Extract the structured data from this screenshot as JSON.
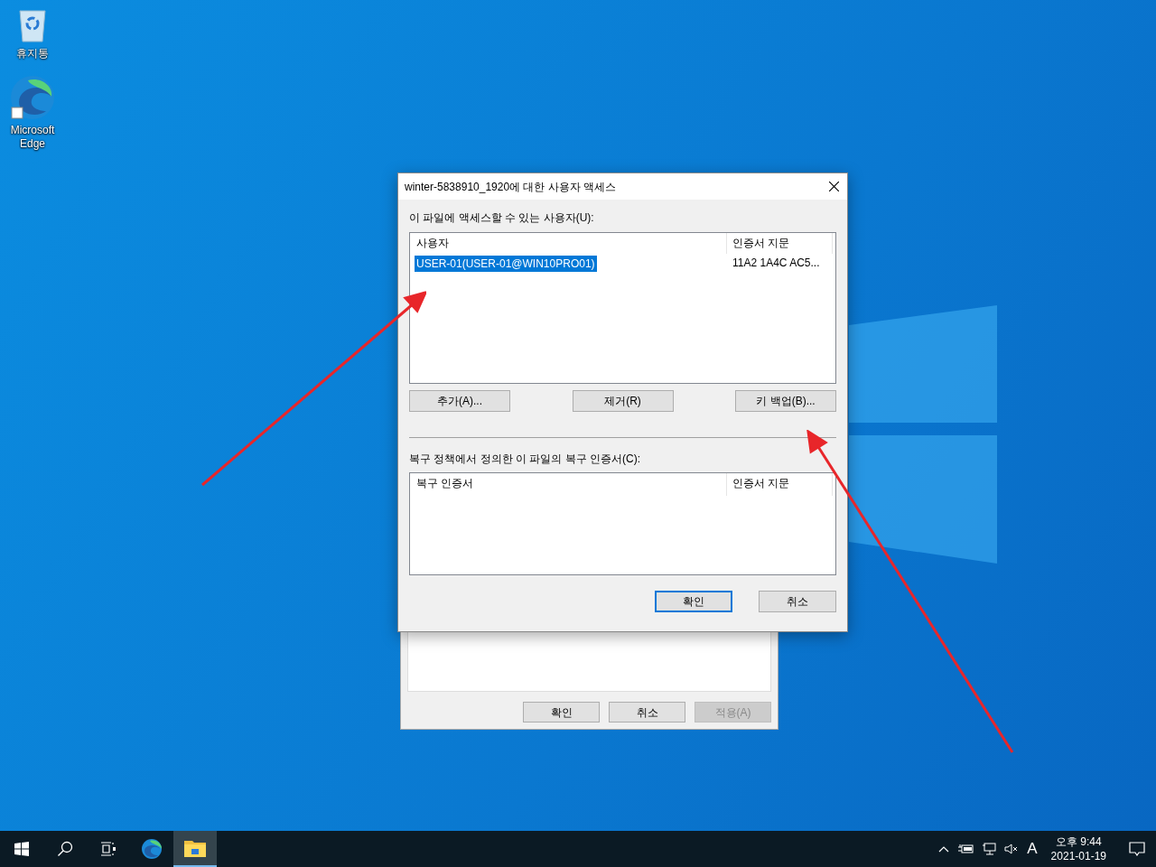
{
  "desktop_icons": [
    {
      "kind": "recycle",
      "label": "휴지통"
    },
    {
      "kind": "edge",
      "label": "Microsoft Edge"
    }
  ],
  "dialog": {
    "title": "winter-5838910_1920에 대한 사용자 액세스",
    "users_label": "이 파일에 액세스할 수 있는 사용자(U):",
    "users_columns": [
      "사용자",
      "인증서 지문"
    ],
    "users_rows": [
      {
        "user": "USER-01(USER-01@WIN10PRO01)",
        "thumbprint": "11A2 1A4C AC5...",
        "selected": true
      }
    ],
    "user_buttons": [
      "추가(A)...",
      "제거(R)",
      "키 백업(B)..."
    ],
    "recovery_label": "복구 정책에서 정의한 이 파일의 복구 인증서(C):",
    "recovery_columns": [
      "복구 인증서",
      "인증서 지문"
    ],
    "buttons": [
      {
        "label": "확인",
        "default": true
      },
      {
        "label": "취소",
        "default": false
      }
    ]
  },
  "back_window": {
    "buttons": [
      {
        "label": "확인",
        "disabled": false
      },
      {
        "label": "취소",
        "disabled": false
      },
      {
        "label": "적용(A)",
        "disabled": true
      }
    ]
  },
  "taskbar": {
    "items": [
      {
        "kind": "start",
        "active": false
      },
      {
        "kind": "search",
        "active": false
      },
      {
        "kind": "taskview",
        "active": false
      },
      {
        "kind": "edge",
        "active": false
      },
      {
        "kind": "explorer",
        "active": true
      }
    ],
    "input_indicator": "A",
    "time": "오후 9:44",
    "date": "2021-01-19"
  }
}
